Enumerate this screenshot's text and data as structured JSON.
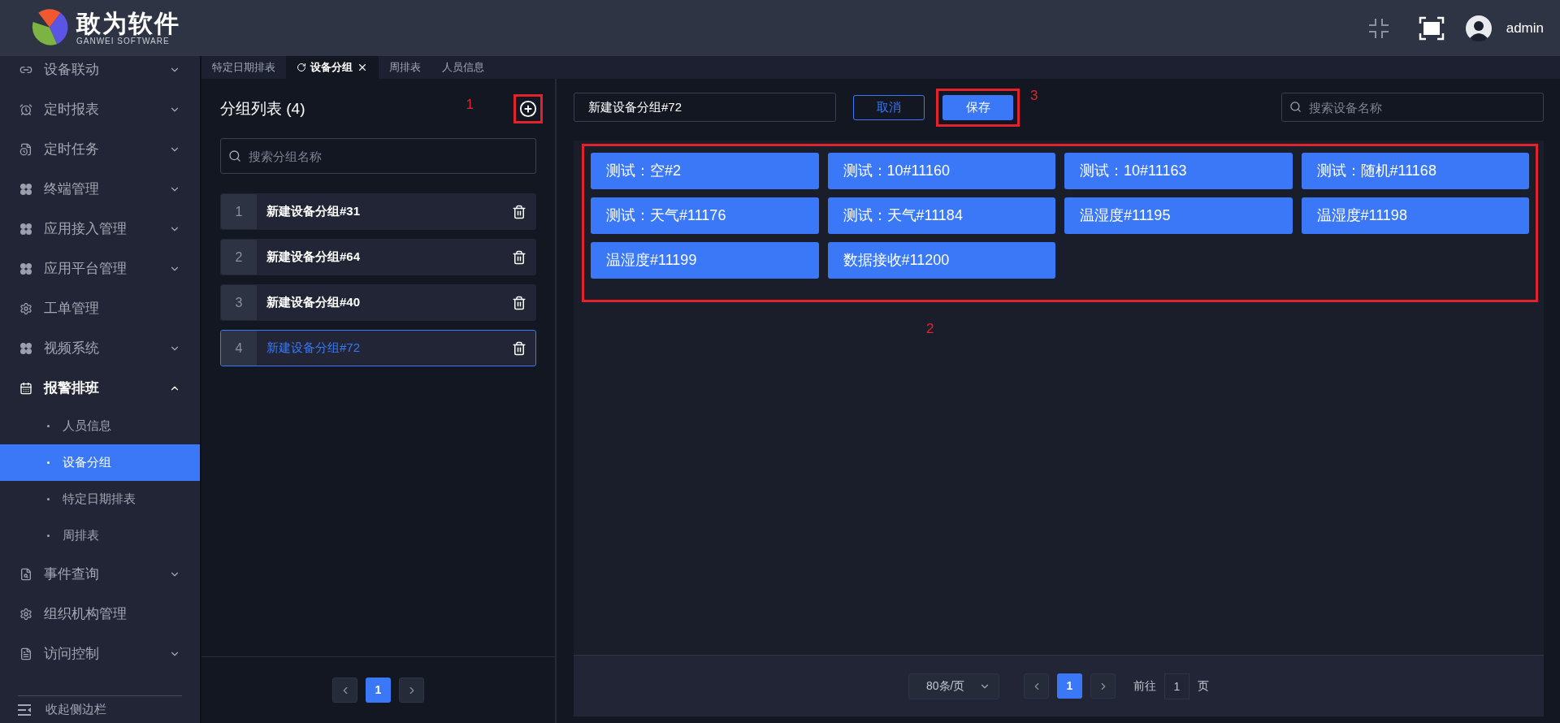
{
  "header": {
    "logo_title": "敢为软件",
    "logo_subtitle": "GANWEI SOFTWARE",
    "user": "admin"
  },
  "sidebar": {
    "items": [
      {
        "label": "设备联动",
        "expandable": true,
        "expanded": false
      },
      {
        "label": "定时报表",
        "expandable": true,
        "expanded": false
      },
      {
        "label": "定时任务",
        "expandable": true,
        "expanded": false
      },
      {
        "label": "终端管理",
        "expandable": true,
        "expanded": false
      },
      {
        "label": "应用接入管理",
        "expandable": true,
        "expanded": false
      },
      {
        "label": "应用平台管理",
        "expandable": true,
        "expanded": false
      },
      {
        "label": "工单管理",
        "expandable": false,
        "expanded": false
      },
      {
        "label": "视频系统",
        "expandable": true,
        "expanded": false
      },
      {
        "label": "报警排班",
        "expandable": true,
        "expanded": true,
        "children": [
          {
            "label": "人员信息",
            "selected": false
          },
          {
            "label": "设备分组",
            "selected": true
          },
          {
            "label": "特定日期排表",
            "selected": false
          },
          {
            "label": "周排表",
            "selected": false
          }
        ]
      },
      {
        "label": "事件查询",
        "expandable": true,
        "expanded": false
      },
      {
        "label": "组织机构管理",
        "expandable": false,
        "expanded": false
      },
      {
        "label": "访问控制",
        "expandable": true,
        "expanded": false
      }
    ],
    "collapse": "收起侧边栏"
  },
  "tabs": [
    {
      "label": "特定日期排表",
      "selected": false,
      "closable": false
    },
    {
      "label": "设备分组",
      "selected": true,
      "closable": true
    },
    {
      "label": "周排表",
      "selected": false,
      "closable": false
    },
    {
      "label": "人员信息",
      "selected": false,
      "closable": false
    }
  ],
  "group_panel": {
    "title": "分组列表 (4)",
    "add_annotation": "1",
    "search_placeholder": "搜索分组名称",
    "groups": [
      {
        "index": "1",
        "name": "新建设备分组#31",
        "selected": false
      },
      {
        "index": "2",
        "name": "新建设备分组#64",
        "selected": false
      },
      {
        "index": "3",
        "name": "新建设备分组#40",
        "selected": false
      },
      {
        "index": "4",
        "name": "新建设备分组#72",
        "selected": true
      }
    ],
    "pages": [
      {
        "label": "1",
        "selected": true
      }
    ]
  },
  "editor": {
    "name_value": "新建设备分组#72",
    "cancel": "取消",
    "save": "保存",
    "save_annotation": "3",
    "search_placeholder": "搜索设备名称",
    "devices": [
      "测试：空#2",
      "测试：10#11160",
      "测试：10#11163",
      "测试：随机#11168",
      "测试：天气#11176",
      "测试：天气#11184",
      "温湿度#11195",
      "温湿度#11198",
      "温湿度#11199",
      "数据接收#11200"
    ],
    "devices_annotation": "2",
    "pagination": {
      "page_size": "80条/页",
      "pages": [
        {
          "label": "1",
          "selected": true
        }
      ],
      "goto_label": "前往",
      "goto_value": "1",
      "page_unit": "页"
    }
  }
}
